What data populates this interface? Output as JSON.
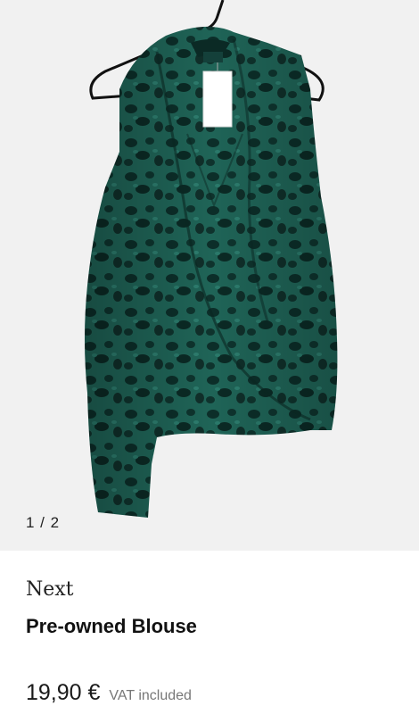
{
  "gallery": {
    "counter": "1 / 2",
    "image_icon": "product-photo-blouse",
    "colors": {
      "fabric": "#1c5a4f",
      "spots": "#0b2a25",
      "background": "#f1f1f1"
    }
  },
  "product": {
    "brand": "Next",
    "title": "Pre-owned Blouse",
    "price": "19,90 €",
    "vat": "VAT included"
  }
}
